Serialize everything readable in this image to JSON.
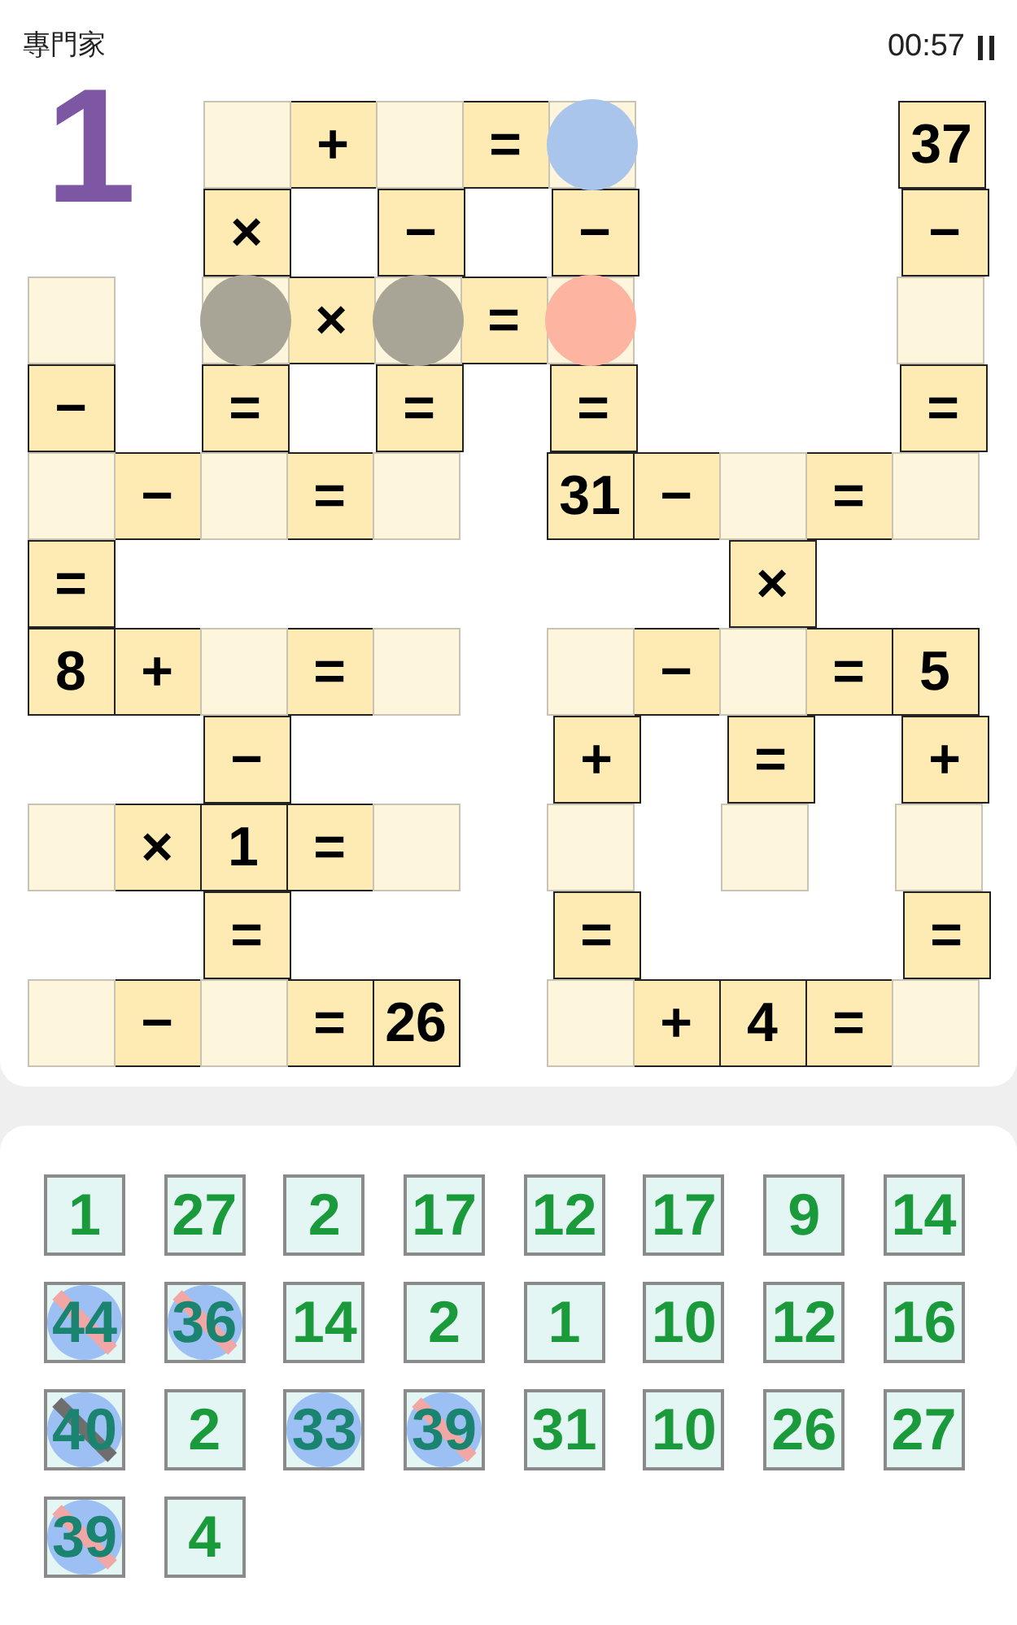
{
  "header": {
    "level_name": "專門家",
    "timer": "00:57"
  },
  "annotation": {
    "text": "1"
  },
  "grid": [
    [
      {
        "kind": "blank"
      },
      {
        "kind": "blank"
      },
      {
        "kind": "empty"
      },
      {
        "kind": "given",
        "text": "+"
      },
      {
        "kind": "empty"
      },
      {
        "kind": "given",
        "text": "="
      },
      {
        "kind": "empty",
        "color": "#a9c5ec"
      },
      {
        "kind": "blank"
      },
      {
        "kind": "blank"
      },
      {
        "kind": "blank"
      },
      {
        "kind": "given",
        "text": "37"
      }
    ],
    [
      {
        "kind": "blank"
      },
      {
        "kind": "blank"
      },
      {
        "kind": "given",
        "text": "×"
      },
      {
        "kind": "blank"
      },
      {
        "kind": "given",
        "text": "−"
      },
      {
        "kind": "blank"
      },
      {
        "kind": "given",
        "text": "−"
      },
      {
        "kind": "blank"
      },
      {
        "kind": "blank"
      },
      {
        "kind": "blank"
      },
      {
        "kind": "given",
        "text": "−"
      }
    ],
    [
      {
        "kind": "empty"
      },
      {
        "kind": "blank"
      },
      {
        "kind": "empty",
        "color": "#a8a596"
      },
      {
        "kind": "given",
        "text": "×"
      },
      {
        "kind": "empty",
        "color": "#a8a596"
      },
      {
        "kind": "given",
        "text": "="
      },
      {
        "kind": "empty",
        "color": "#fdb5a2"
      },
      {
        "kind": "blank"
      },
      {
        "kind": "blank"
      },
      {
        "kind": "blank"
      },
      {
        "kind": "empty"
      }
    ],
    [
      {
        "kind": "given",
        "text": "−"
      },
      {
        "kind": "blank"
      },
      {
        "kind": "given",
        "text": "="
      },
      {
        "kind": "blank"
      },
      {
        "kind": "given",
        "text": "="
      },
      {
        "kind": "blank"
      },
      {
        "kind": "given",
        "text": "="
      },
      {
        "kind": "blank"
      },
      {
        "kind": "blank"
      },
      {
        "kind": "blank"
      },
      {
        "kind": "given",
        "text": "="
      }
    ],
    [
      {
        "kind": "empty"
      },
      {
        "kind": "given",
        "text": "−"
      },
      {
        "kind": "empty"
      },
      {
        "kind": "given",
        "text": "="
      },
      {
        "kind": "empty"
      },
      {
        "kind": "blank"
      },
      {
        "kind": "given",
        "text": "31"
      },
      {
        "kind": "given",
        "text": "−"
      },
      {
        "kind": "empty"
      },
      {
        "kind": "given",
        "text": "="
      },
      {
        "kind": "empty"
      }
    ],
    [
      {
        "kind": "given",
        "text": "="
      },
      {
        "kind": "blank"
      },
      {
        "kind": "blank"
      },
      {
        "kind": "blank"
      },
      {
        "kind": "blank"
      },
      {
        "kind": "blank"
      },
      {
        "kind": "blank"
      },
      {
        "kind": "blank"
      },
      {
        "kind": "given",
        "text": "×"
      },
      {
        "kind": "blank"
      },
      {
        "kind": "blank"
      }
    ],
    [
      {
        "kind": "given",
        "text": "8"
      },
      {
        "kind": "given",
        "text": "+"
      },
      {
        "kind": "empty"
      },
      {
        "kind": "given",
        "text": "="
      },
      {
        "kind": "empty"
      },
      {
        "kind": "blank"
      },
      {
        "kind": "empty"
      },
      {
        "kind": "given",
        "text": "−"
      },
      {
        "kind": "empty"
      },
      {
        "kind": "given",
        "text": "="
      },
      {
        "kind": "given",
        "text": "5"
      }
    ],
    [
      {
        "kind": "blank"
      },
      {
        "kind": "blank"
      },
      {
        "kind": "given",
        "text": "−"
      },
      {
        "kind": "blank"
      },
      {
        "kind": "blank"
      },
      {
        "kind": "blank"
      },
      {
        "kind": "given",
        "text": "+"
      },
      {
        "kind": "blank"
      },
      {
        "kind": "given",
        "text": "="
      },
      {
        "kind": "blank"
      },
      {
        "kind": "given",
        "text": "+"
      }
    ],
    [
      {
        "kind": "empty"
      },
      {
        "kind": "given",
        "text": "×"
      },
      {
        "kind": "given",
        "text": "1"
      },
      {
        "kind": "given",
        "text": "="
      },
      {
        "kind": "empty"
      },
      {
        "kind": "blank"
      },
      {
        "kind": "empty"
      },
      {
        "kind": "blank"
      },
      {
        "kind": "empty"
      },
      {
        "kind": "blank"
      },
      {
        "kind": "empty"
      }
    ],
    [
      {
        "kind": "blank"
      },
      {
        "kind": "blank"
      },
      {
        "kind": "given",
        "text": "="
      },
      {
        "kind": "blank"
      },
      {
        "kind": "blank"
      },
      {
        "kind": "blank"
      },
      {
        "kind": "given",
        "text": "="
      },
      {
        "kind": "blank"
      },
      {
        "kind": "blank"
      },
      {
        "kind": "blank"
      },
      {
        "kind": "given",
        "text": "="
      }
    ],
    [
      {
        "kind": "empty"
      },
      {
        "kind": "given",
        "text": "−"
      },
      {
        "kind": "empty"
      },
      {
        "kind": "given",
        "text": "="
      },
      {
        "kind": "given",
        "text": "26"
      },
      {
        "kind": "blank"
      },
      {
        "kind": "empty"
      },
      {
        "kind": "given",
        "text": "+"
      },
      {
        "kind": "given",
        "text": "4"
      },
      {
        "kind": "given",
        "text": "="
      },
      {
        "kind": "empty"
      }
    ]
  ],
  "tiles": [
    {
      "value": "1",
      "circled": false,
      "struck": false
    },
    {
      "value": "27",
      "circled": false,
      "struck": false
    },
    {
      "value": "2",
      "circled": false,
      "struck": false
    },
    {
      "value": "17",
      "circled": false,
      "struck": false
    },
    {
      "value": "12",
      "circled": false,
      "struck": false
    },
    {
      "value": "17",
      "circled": false,
      "struck": false
    },
    {
      "value": "9",
      "circled": false,
      "struck": false
    },
    {
      "value": "14",
      "circled": false,
      "struck": false
    },
    {
      "value": "44",
      "circled": true,
      "struck": true,
      "color": "#f2a7a7"
    },
    {
      "value": "36",
      "circled": true,
      "struck": true,
      "color": "#f2a7a7"
    },
    {
      "value": "14",
      "circled": false,
      "struck": false
    },
    {
      "value": "2",
      "circled": false,
      "struck": false
    },
    {
      "value": "1",
      "circled": false,
      "struck": false
    },
    {
      "value": "10",
      "circled": false,
      "struck": false
    },
    {
      "value": "12",
      "circled": false,
      "struck": false
    },
    {
      "value": "16",
      "circled": false,
      "struck": false
    },
    {
      "value": "40",
      "circled": true,
      "struck": true,
      "color": "#6e6e6e"
    },
    {
      "value": "2",
      "circled": false,
      "struck": false
    },
    {
      "value": "33",
      "circled": true,
      "struck": false
    },
    {
      "value": "39",
      "circled": true,
      "struck": true,
      "color": "#f2a7a7"
    },
    {
      "value": "31",
      "circled": false,
      "struck": false
    },
    {
      "value": "10",
      "circled": false,
      "struck": false
    },
    {
      "value": "26",
      "circled": false,
      "struck": false
    },
    {
      "value": "27",
      "circled": false,
      "struck": false
    },
    {
      "value": "39",
      "circled": true,
      "struck": true,
      "color": "#f2a7a7"
    },
    {
      "value": "4",
      "circled": false,
      "struck": false
    }
  ]
}
